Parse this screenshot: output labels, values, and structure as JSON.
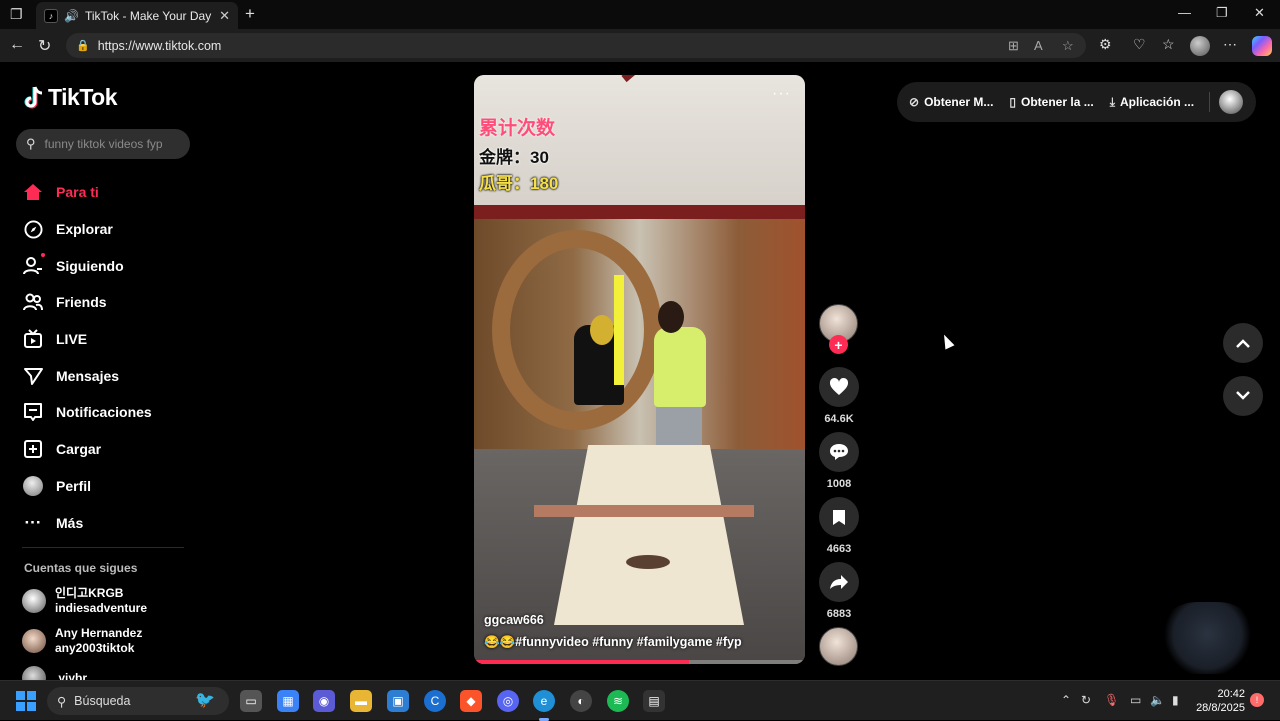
{
  "browser": {
    "tab_title": "TikTok - Make Your Day",
    "url": "https://www.tiktok.com"
  },
  "sidebar": {
    "logo": "TikTok",
    "search_placeholder": "funny tiktok videos fyp",
    "nav": [
      {
        "label": "Para ti",
        "icon": "home-icon",
        "active": true
      },
      {
        "label": "Explorar",
        "icon": "compass-icon"
      },
      {
        "label": "Siguiendo",
        "icon": "following-icon"
      },
      {
        "label": "Friends",
        "icon": "friends-icon"
      },
      {
        "label": "LIVE",
        "icon": "live-icon"
      },
      {
        "label": "Mensajes",
        "icon": "messages-icon"
      },
      {
        "label": "Notificaciones",
        "icon": "notifications-icon"
      },
      {
        "label": "Cargar",
        "icon": "upload-icon"
      },
      {
        "label": "Perfil",
        "icon": "profile-avatar"
      },
      {
        "label": "Más",
        "icon": "more-icon"
      }
    ],
    "following_title": "Cuentas que sigues",
    "accounts": [
      {
        "name": "인디고KRGB",
        "handle": "indiesadventure"
      },
      {
        "name": "Any Hernandez",
        "handle": "any2003tiktok"
      },
      {
        "name": ".yiybr",
        "handle": ""
      }
    ]
  },
  "video": {
    "overlay_title": "累计次数",
    "overlay_line1": "金牌：30",
    "overlay_line2": "瓜哥：180",
    "author": "ggcaw666",
    "caption": "😂😂#funnyvideo #funny #familygame #fyp",
    "progress": 0.65
  },
  "actions": {
    "likes": "64.6K",
    "comments": "1008",
    "saves": "4663",
    "shares": "6883"
  },
  "top_bar": {
    "item1": "Obtener M...",
    "item2": "Obtener la ...",
    "item3": "Aplicación ..."
  },
  "taskbar": {
    "search_label": "Búsqueda",
    "time": "20:42",
    "date": "28/8/2025"
  },
  "colors": {
    "accent": "#fe2c55",
    "background": "#000000"
  }
}
